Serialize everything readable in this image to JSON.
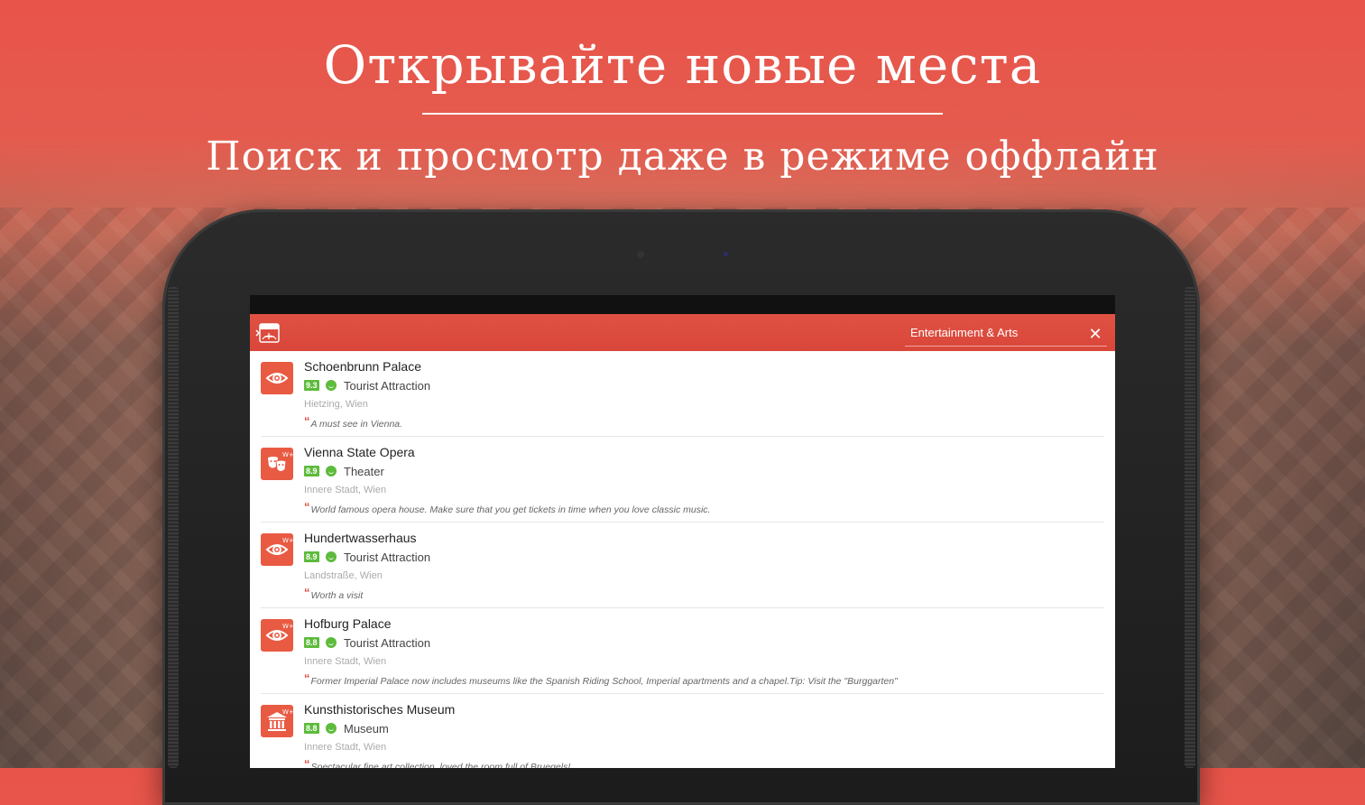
{
  "promo": {
    "title": "Открывайте новые места",
    "subtitle": "Поиск и просмотр даже в режиме оффлайн"
  },
  "appbar": {
    "search_value": "Entertainment & Arts"
  },
  "places": [
    {
      "name": "Schoenbrunn Palace",
      "rating": "9.3",
      "category": "Tourist Attraction",
      "location": "Hietzing, Wien",
      "quote": "A must see in Vienna.",
      "icon": "eye-icon",
      "badge": ""
    },
    {
      "name": "Vienna State Opera",
      "rating": "8.9",
      "category": "Theater",
      "location": "Innere Stadt, Wien",
      "quote": "World famous opera house. Make sure that you get tickets in time when you love classic music.",
      "icon": "theater-masks-icon",
      "badge": "W+"
    },
    {
      "name": "Hundertwasserhaus",
      "rating": "8.9",
      "category": "Tourist Attraction",
      "location": "Landstraße, Wien",
      "quote": "Worth a visit",
      "icon": "eye-icon",
      "badge": "W+"
    },
    {
      "name": "Hofburg Palace",
      "rating": "8.8",
      "category": "Tourist Attraction",
      "location": "Innere Stadt, Wien",
      "quote": "Former Imperial Palace now includes museums like the Spanish Riding School, Imperial apartments and a chapel.Tip: Visit the \"Burggarten\"",
      "icon": "eye-icon",
      "badge": "W+"
    },
    {
      "name": "Kunsthistorisches Museum",
      "rating": "8.8",
      "category": "Museum",
      "location": "Innere Stadt, Wien",
      "quote": "Spectacular fine art collection, loved the room full of Bruegels!",
      "icon": "museum-icon",
      "badge": "W+"
    }
  ],
  "colors": {
    "accent": "#e95a43",
    "appbar": "#d9463a",
    "rating": "#5dbb3c"
  }
}
